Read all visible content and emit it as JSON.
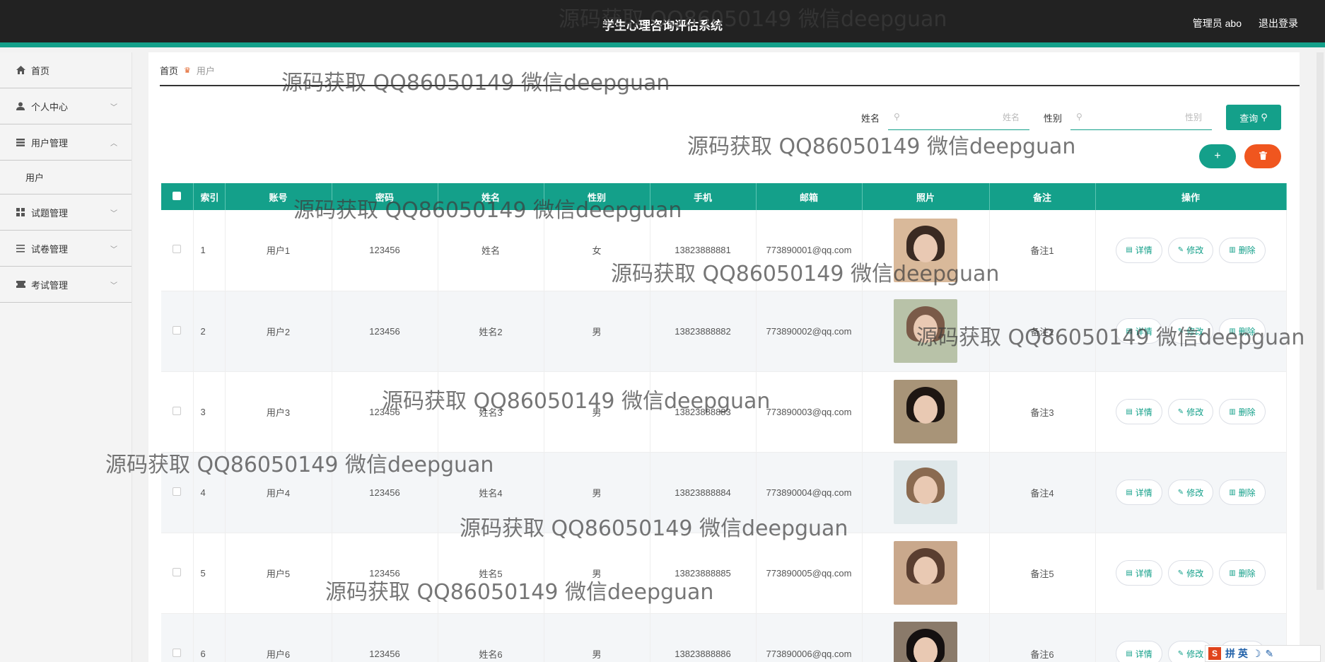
{
  "header": {
    "title": "学生心理咨询评估系统",
    "admin": "管理员 abo",
    "logout": "退出登录"
  },
  "sidebar": {
    "home": "首页",
    "personal": "个人中心",
    "user_mgmt": "用户管理",
    "user_sub": "用户",
    "question_mgmt": "试题管理",
    "paper_mgmt": "试卷管理",
    "exam_mgmt": "考试管理"
  },
  "breadcrumb": {
    "home": "首页",
    "current": "用户"
  },
  "search": {
    "name_label": "姓名",
    "name_placeholder": "姓名",
    "gender_label": "性别",
    "gender_placeholder": "性别",
    "query_label": "查询"
  },
  "table": {
    "headers": [
      "索引",
      "账号",
      "密码",
      "姓名",
      "性别",
      "手机",
      "邮箱",
      "照片",
      "备注",
      "操作"
    ],
    "rows": [
      {
        "index": "1",
        "account": "用户1",
        "password": "123456",
        "name": "姓名",
        "gender": "女",
        "phone": "13823888881",
        "email": "773890001@qq.com",
        "note": "备注1"
      },
      {
        "index": "2",
        "account": "用户2",
        "password": "123456",
        "name": "姓名2",
        "gender": "男",
        "phone": "13823888882",
        "email": "773890002@qq.com",
        "note": "备注2"
      },
      {
        "index": "3",
        "account": "用户3",
        "password": "123456",
        "name": "姓名3",
        "gender": "男",
        "phone": "13823888883",
        "email": "773890003@qq.com",
        "note": "备注3"
      },
      {
        "index": "4",
        "account": "用户4",
        "password": "123456",
        "name": "姓名4",
        "gender": "男",
        "phone": "13823888884",
        "email": "773890004@qq.com",
        "note": "备注4"
      },
      {
        "index": "5",
        "account": "用户5",
        "password": "123456",
        "name": "姓名5",
        "gender": "男",
        "phone": "13823888885",
        "email": "773890005@qq.com",
        "note": "备注5"
      },
      {
        "index": "6",
        "account": "用户6",
        "password": "123456",
        "name": "姓名6",
        "gender": "男",
        "phone": "13823888886",
        "email": "773890006@qq.com",
        "note": "备注6"
      }
    ],
    "actions": {
      "detail": "详情",
      "edit": "修改",
      "delete": "删除"
    }
  },
  "watermark": "源码获取 QQ86050149 微信deepguan",
  "ime": {
    "label": "拼 英"
  },
  "colors": {
    "accent": "#14a08a",
    "danger": "#f0561f",
    "header_bg": "#222222"
  }
}
